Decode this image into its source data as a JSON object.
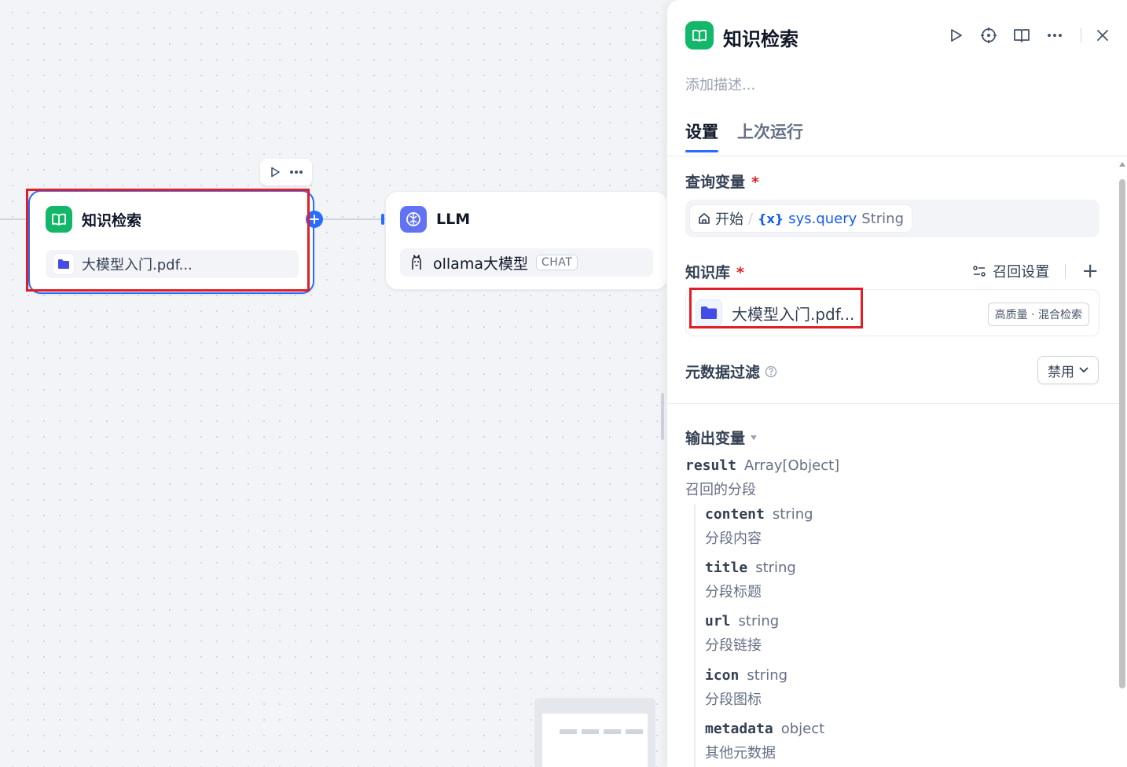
{
  "canvas": {
    "kr_node": {
      "title": "知识检索",
      "dataset": "大模型入门.pdf..."
    },
    "llm_node": {
      "title": "LLM",
      "model": "ollama大模型",
      "mode": "CHAT"
    }
  },
  "panel": {
    "title": "知识检索",
    "description_placeholder": "添加描述...",
    "tabs": [
      {
        "label": "设置",
        "active": true
      },
      {
        "label": "上次运行",
        "active": false
      }
    ],
    "query_variable": {
      "label": "查询变量",
      "required_mark": "*",
      "source": "开始",
      "separator": "/",
      "var_icon": "{x}",
      "var_name": "sys.query",
      "var_type": "String"
    },
    "knowledge": {
      "label": "知识库",
      "required_mark": "*",
      "recall_settings": "召回设置",
      "add": "+",
      "item_name": "大模型入门.pdf...",
      "item_badge": "高质量 · 混合检索"
    },
    "metadata_filter": {
      "label": "元数据过滤",
      "value": "禁用"
    },
    "output": {
      "label": "输出变量",
      "result": {
        "name": "result",
        "type": "Array[Object]",
        "desc": "召回的分段"
      },
      "children": [
        {
          "name": "content",
          "type": "string",
          "desc": "分段内容"
        },
        {
          "name": "title",
          "type": "string",
          "desc": "分段标题"
        },
        {
          "name": "url",
          "type": "string",
          "desc": "分段链接"
        },
        {
          "name": "icon",
          "type": "string",
          "desc": "分段图标"
        },
        {
          "name": "metadata",
          "type": "object",
          "desc": "其他元数据"
        }
      ]
    }
  },
  "colors": {
    "accent": "#296dff",
    "node_green": "#12b76a",
    "node_llm": "#6172f3",
    "annotation_red": "#e21d27"
  },
  "icons": [
    "book-icon",
    "play-icon",
    "more-icon",
    "folder-icon",
    "llm-icon",
    "llama-icon",
    "locate-icon",
    "help-book-icon",
    "close-icon",
    "home-icon",
    "recall-settings-icon",
    "chevron-down-icon",
    "help-circle-icon",
    "caret-down-icon"
  ]
}
